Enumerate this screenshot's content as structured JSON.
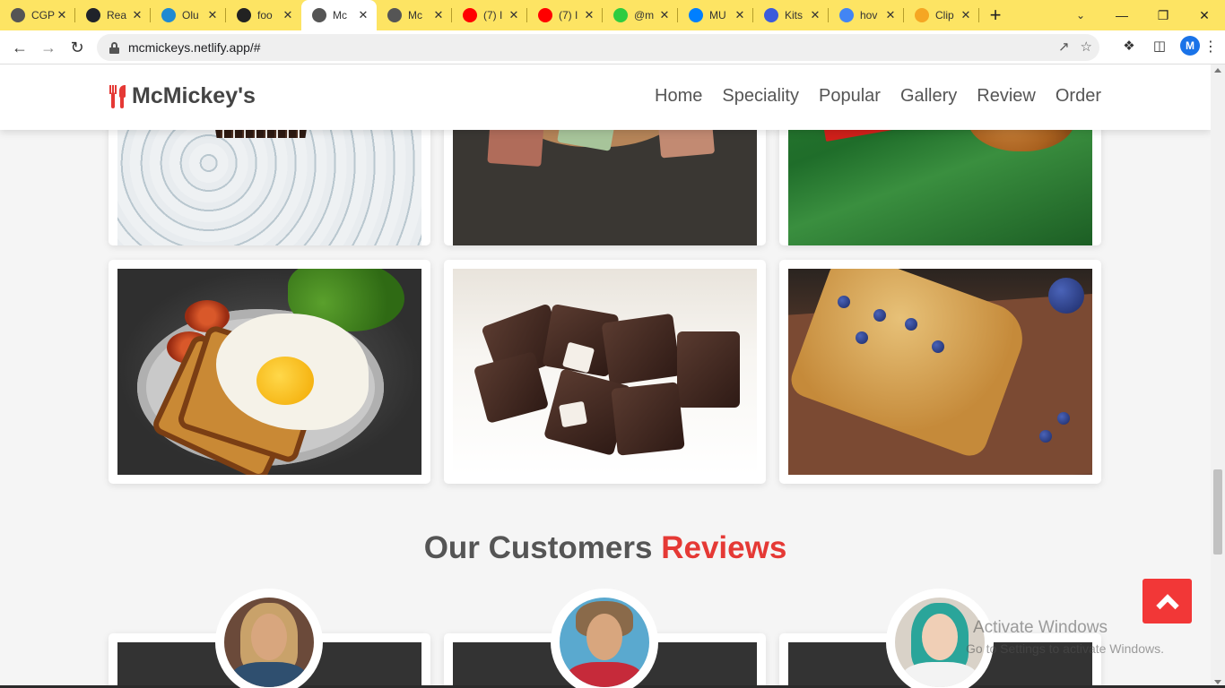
{
  "browser": {
    "tabs": [
      {
        "title": "CGP",
        "icon": "globe-icon",
        "color": "#555555"
      },
      {
        "title": "Rea",
        "icon": "react-icon",
        "color": "#20232a"
      },
      {
        "title": "Olu",
        "icon": "vscode-icon",
        "color": "#1f8ad2"
      },
      {
        "title": "foo",
        "icon": "github-icon",
        "color": "#222222"
      },
      {
        "title": "Mc",
        "icon": "globe-icon",
        "color": "#555555",
        "active": true
      },
      {
        "title": "Mc",
        "icon": "globe-icon",
        "color": "#555555"
      },
      {
        "title": "(7) I",
        "icon": "youtube-icon",
        "color": "#ff0000"
      },
      {
        "title": "(7) I",
        "icon": "youtube-icon",
        "color": "#ff0000"
      },
      {
        "title": "@m",
        "icon": "asterisk-icon",
        "color": "#2ecc40"
      },
      {
        "title": "MU",
        "icon": "mui-icon",
        "color": "#007fff"
      },
      {
        "title": "Kits",
        "icon": "flag-icon",
        "color": "#3b5bdb"
      },
      {
        "title": "hov",
        "icon": "google-icon",
        "color": "#4285f4"
      },
      {
        "title": "Clip",
        "icon": "clipchamp-icon",
        "color": "#f5a623"
      }
    ],
    "address": "mcmickeys.netlify.app/#",
    "profile_initial": "M"
  },
  "site": {
    "brand": "McMickey's",
    "nav": [
      "Home",
      "Speciality",
      "Popular",
      "Gallery",
      "Review",
      "Order"
    ],
    "reviews_title": "Our Customers",
    "reviews_title_accent": "Reviews"
  },
  "gallery": [
    {
      "name": "cupcake"
    },
    {
      "name": "fudge"
    },
    {
      "name": "fried-chicken"
    },
    {
      "name": "egg-toast"
    },
    {
      "name": "chocolate-bites"
    },
    {
      "name": "blueberry-bread"
    }
  ],
  "overlay": {
    "activate_title": "Activate Windows",
    "activate_sub": "Go to Settings to activate Windows."
  },
  "colors": {
    "accent": "#e53935",
    "tabstrip": "#fde463",
    "scroll_top_button": "#f23737"
  }
}
